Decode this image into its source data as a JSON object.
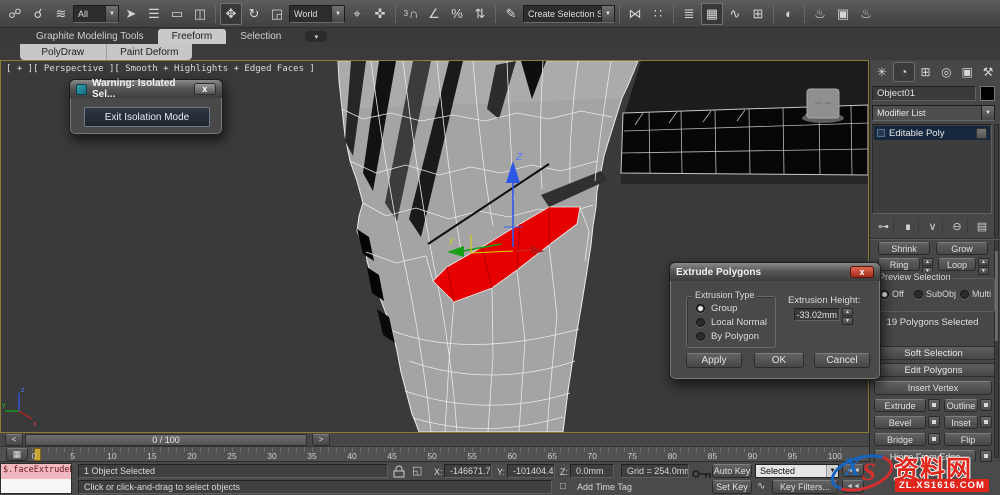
{
  "toolbar": {
    "icons_a": [
      "☍",
      "☌",
      "≋"
    ],
    "filter_dropdown": "All",
    "icons_b": [
      "➤",
      "☰",
      "▭",
      "◫"
    ],
    "icons_c": [
      "✥",
      "↻",
      "◲"
    ],
    "reference_dropdown": "World",
    "icons_d": [
      "⌖",
      "✜"
    ],
    "snap_digit": "3",
    "icons_e": [
      "∩",
      "∠",
      "%",
      "⇅"
    ],
    "named_sets_glyph": "✎",
    "selection_set_dropdown": "Create Selection Se",
    "icons_g": [
      "⋈",
      "∷"
    ],
    "icons_h": [
      "≣",
      "▦",
      "∿",
      "⊞"
    ],
    "icons_i": [
      "◐"
    ],
    "icons_j": [
      "♨",
      "▣",
      "♨"
    ]
  },
  "ribbon": {
    "tab_graphite": "Graphite Modeling Tools",
    "tab_freeform": "Freeform",
    "tab_selection": "Selection",
    "expand_glyph": "▾",
    "panel_polydraw": "PolyDraw",
    "panel_paintdeform": "Paint Deform"
  },
  "viewport": {
    "label": "[ + ][ Perspective ][ Smooth + Highlights + Edged Faces ]",
    "gizmo_z": "Z",
    "gizmo_y": "y",
    "axis_x": "x",
    "axis_y": "y",
    "axis_z": "z"
  },
  "warning_dialog": {
    "title": "Warning: Isolated Sel...",
    "close": "x",
    "exit_button": "Exit Isolation Mode"
  },
  "extrude_dialog": {
    "title": "Extrude Polygons",
    "close": "x",
    "group_label": "Extrusion Type",
    "option_group": "Group",
    "option_local_normal": "Local Normal",
    "option_by_polygon": "By Polygon",
    "height_label": "Extrusion Height:",
    "height_value": "-33.02mm",
    "apply": "Apply",
    "ok": "OK",
    "cancel": "Cancel"
  },
  "command_panel": {
    "tabs": [
      "✳",
      "◔",
      "⊞",
      "◎",
      "▣",
      "⚒"
    ],
    "object_name": "Object01",
    "modifier_list_label": "Modifier List",
    "stack_item": "Editable Poly",
    "stack_icons": [
      "⊶",
      "∎",
      "∨",
      "⊖",
      "▤"
    ],
    "shrink": "Shrink",
    "grow": "Grow",
    "ring": "Ring",
    "loop": "Loop",
    "preview_label": "Preview Selection",
    "preview_off": "Off",
    "preview_subobj": "SubObj",
    "preview_multi": "Multi",
    "selection_status": "19 Polygons Selected",
    "rollout_soft_selection": "Soft Selection",
    "rollout_edit_polygons": "Edit Polygons",
    "insert_vertex": "Insert Vertex",
    "extrude": "Extrude",
    "outline": "Outline",
    "bevel": "Bevel",
    "inset": "Inset",
    "bridge": "Bridge",
    "flip": "Flip",
    "hinge": "Hinge From Edge"
  },
  "timeline": {
    "prev_label": "<",
    "next_label": ">",
    "slider_value": "0 / 100",
    "ruler_icon": "▦",
    "ticks": [
      "0",
      "5",
      "10",
      "15",
      "20",
      "25",
      "30",
      "35",
      "40",
      "45",
      "50",
      "55",
      "60",
      "65",
      "70",
      "75",
      "80",
      "85",
      "90",
      "95",
      "100"
    ]
  },
  "status_bar": {
    "maxscript_line": "$.faceExtrudeH",
    "selection_status": "1 Object Selected",
    "prompt": "Click or click-and-drag to select objects",
    "x_label": "X:",
    "x_value": "-146671.7",
    "y_label": "Y:",
    "y_value": "-101404.4",
    "z_label": "Z:",
    "z_value": "0.0mm",
    "grid_label": "Grid = 254.0mm",
    "time_tag_icon": "□",
    "add_time_tag": "Add Time Tag",
    "auto_key": "Auto Key",
    "set_key": "Set Key",
    "curve_glyph": "∿",
    "selected_dropdown": "Selected",
    "key_filters": "Key Filters...",
    "play_glyph": "◄◄"
  },
  "watermark": {
    "logo_x": "X",
    "logo_s": "S",
    "site_name": "资料网",
    "url": "ZL.XS1616.COM"
  },
  "colors": {
    "selection_red": "#e60000",
    "viewport_border": "#8b7d3a",
    "gizmo_z_blue": "#2e57e8",
    "gizmo_y_green": "#18a018"
  }
}
